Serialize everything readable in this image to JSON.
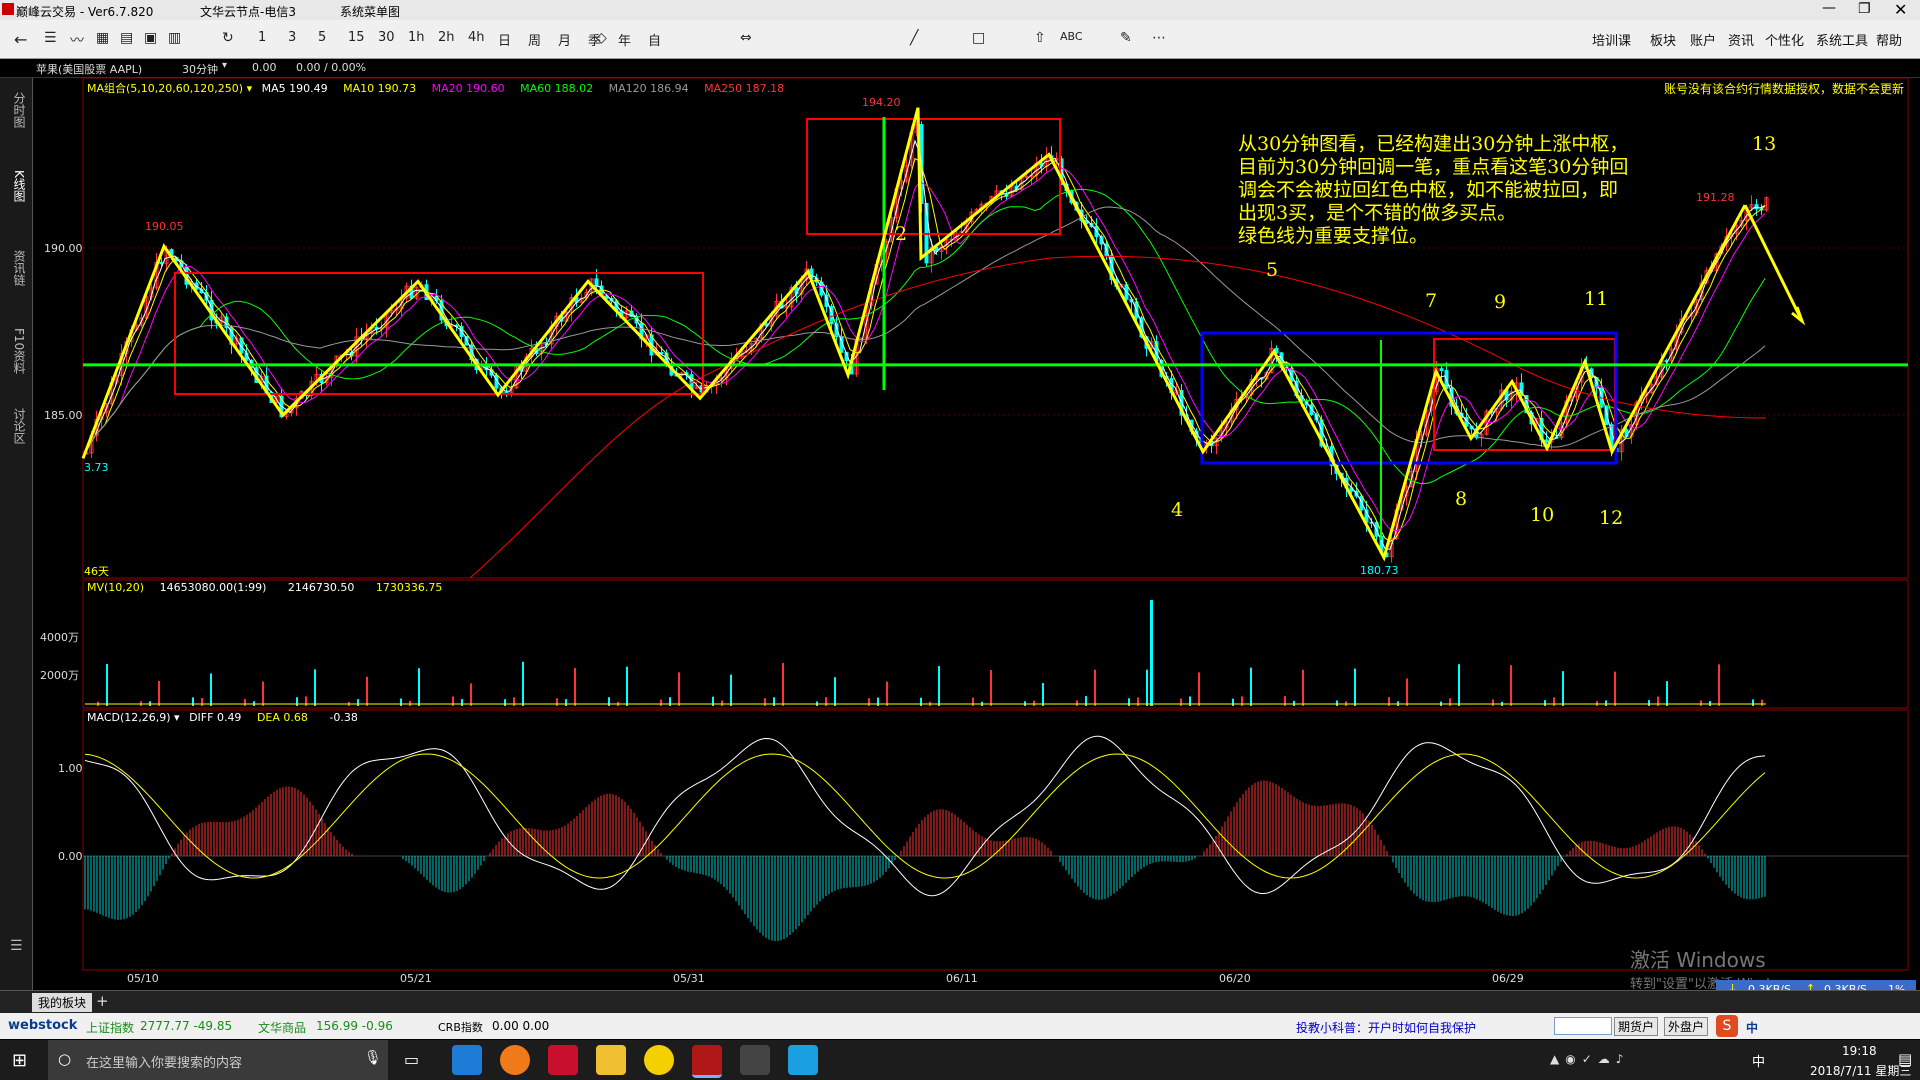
{
  "app": {
    "title": "巅峰云交易  -  Ver6.7.820",
    "server": "文华云节点-电信3",
    "menu_label": "系统菜单图"
  },
  "toolbar": {
    "periods": [
      "1",
      "3",
      "5",
      "15",
      "30",
      "1h",
      "2h",
      "4h",
      "日",
      "周",
      "月",
      "季",
      "年",
      "自"
    ],
    "right_menu": [
      "培训课",
      "板块",
      "账户",
      "资讯",
      "个性化",
      "系统工具",
      "帮助"
    ]
  },
  "infobar": {
    "symbol": "苹果(美国股票 AAPL)",
    "period": "30分钟",
    "price": "0.00",
    "change": "0.00 / 0.00%"
  },
  "sidebar": {
    "tabs": [
      "分时图",
      "K线图",
      "资讯链",
      "F10资料",
      "讨论区"
    ]
  },
  "main_panel": {
    "ma_label": "MA组合(5,10,20,60,120,250)",
    "ma5": "MA5 190.49",
    "ma10": "MA10 190.73",
    "ma20": "MA20 190.60",
    "ma60": "MA60 188.02",
    "ma120": "MA120 186.94",
    "ma250": "MA250 187.18",
    "notice": "账号没有该合约行情数据授权，数据不会更新",
    "y_ticks": [
      "190.00",
      "185.00"
    ],
    "price_labels": {
      "p1": "190.05",
      "p2": "194.20",
      "p3": "191.28",
      "p4": "180.73",
      "p5": "3.73"
    },
    "days_label": "46天",
    "annotation": [
      "从30分钟图看，已经构建出30分钟上涨中枢，",
      "目前为30分钟回调一笔，重点看这笔30分钟回",
      "调会不会被拉回红色中枢，如不能被拉回，即",
      "出现3买，是个不错的做多买点。",
      "绿色线为重要支撑位。"
    ],
    "wave_numbers": [
      "2",
      "4",
      "5",
      "7",
      "8",
      "9",
      "10",
      "11",
      "12",
      "13"
    ]
  },
  "volume_panel": {
    "label": "MV(10,20)",
    "v1": "14653080.00(1:99)",
    "v2": "2146730.50",
    "v3": "1730336.75",
    "y_ticks": [
      "4000万",
      "2000万"
    ]
  },
  "macd_panel": {
    "label": "MACD(12,26,9)",
    "diff": "DIFF 0.49",
    "dea": "DEA 0.68",
    "macd": "-0.38",
    "y_ticks": [
      "1.00",
      "0.00"
    ]
  },
  "x_dates": [
    "05/10",
    "05/21",
    "05/31",
    "06/11",
    "06/20",
    "06/29"
  ],
  "watermark": {
    "line1": "激活 Windows",
    "line2": "转到\"设置\"以激活 Windows"
  },
  "bottom_tabs": {
    "tab1": "我的板块",
    "add": "+"
  },
  "statusbar": {
    "logo": "webstock",
    "idx1_name": "上证指数",
    "idx1_val": "2777.77 -49.85",
    "idx2_name": "文华商品",
    "idx2_val": "156.99 -0.96",
    "idx3_name": "CRB指数",
    "idx3_val": "0.00 0.00",
    "tip": "投教小科普：开户时如何自我保护",
    "btn1": "期货户",
    "btn2": "外盘户",
    "net_down": "0.3KB/S",
    "net_up": "0.3KB/S",
    "net_pct": "1%"
  },
  "taskbar": {
    "search": "在这里输入你要搜索的内容",
    "time": "19:18",
    "date": "2018/7/11 星期三",
    "ime": "中"
  },
  "colors": {
    "up": "#ff3333",
    "down": "#00ffff",
    "ma5": "#ffffff",
    "ma10": "#ffff00",
    "ma20": "#ff00ff",
    "ma60": "#00ff00",
    "ma120": "#999999",
    "ma250": "#ff0000",
    "support": "#00ff00",
    "stroke": "#ffff00"
  },
  "chart_data": {
    "type": "candlestick",
    "title": "苹果(美国股票 AAPL) 30分钟",
    "ylim": [
      179.5,
      195.5
    ],
    "support_line": 186.5,
    "x_labels": [
      "05/10",
      "05/21",
      "05/31",
      "06/11",
      "06/20",
      "06/29"
    ],
    "stroke_points": [
      {
        "label": "start",
        "value": 183.7
      },
      {
        "label": "peak",
        "value": 190.05
      },
      {
        "label": "low",
        "value": 185.0
      },
      {
        "label": "high",
        "value": 189.0
      },
      {
        "label": "low",
        "value": 185.6
      },
      {
        "label": "high",
        "value": 189.0
      },
      {
        "label": "low",
        "value": 185.5
      },
      {
        "label": "high",
        "value": 189.3
      },
      {
        "label": "low",
        "value": 186.2
      },
      {
        "label": "peak",
        "value": 194.2
      },
      {
        "label": "2",
        "value": 189.7
      },
      {
        "label": "high",
        "value": 192.8
      },
      {
        "label": "4",
        "value": 183.9
      },
      {
        "label": "5",
        "value": 186.9
      },
      {
        "label": "low",
        "value": 180.73
      },
      {
        "label": "7",
        "value": 186.3
      },
      {
        "label": "8",
        "value": 184.3
      },
      {
        "label": "9",
        "value": 186.0
      },
      {
        "label": "10",
        "value": 184.0
      },
      {
        "label": "11",
        "value": 186.6
      },
      {
        "label": "12",
        "value": 183.9
      },
      {
        "label": "13",
        "value": 191.28
      }
    ]
  }
}
